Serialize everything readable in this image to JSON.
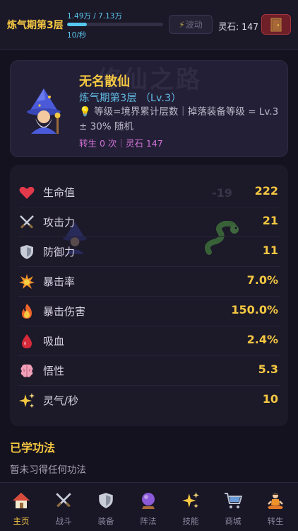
{
  "topbar": {
    "realm": "炼气期第3层",
    "exp_text": "1.49万 / 7.13万",
    "exp_progress": 0.209,
    "rate_text": "10/秒",
    "ripple_label": "波动",
    "stones_text": "灵石: 147",
    "exit_icon": "door-icon"
  },
  "profile": {
    "watermark": "修仙之路",
    "name": "无名散仙",
    "level": "炼气期第3层 （Lv.3）",
    "hint": "等级=境界累计层数｜掉落装备等级 = Lv.3 ± 30% 随机",
    "rebirth": "转生 0 次｜灵石 147"
  },
  "stats": [
    {
      "icon": "heart-icon",
      "label": "生命值",
      "value": "222"
    },
    {
      "icon": "crossed-swords-icon",
      "label": "攻击力",
      "value": "21"
    },
    {
      "icon": "shield-icon",
      "label": "防御力",
      "value": "11"
    },
    {
      "icon": "collision-icon",
      "label": "暴击率",
      "value": "7.0%"
    },
    {
      "icon": "fire-icon",
      "label": "暴击伤害",
      "value": "150.0%"
    },
    {
      "icon": "blood-drop-icon",
      "label": "吸血",
      "value": "2.4%"
    },
    {
      "icon": "brain-icon",
      "label": "悟性",
      "value": "5.3"
    },
    {
      "icon": "sparkles-icon",
      "label": "灵气/秒",
      "value": "10"
    }
  ],
  "ghost_number": "-19",
  "skills": {
    "title": "已学功法",
    "empty_text": "暂未习得任何功法"
  },
  "nav": [
    {
      "icon": "house-icon",
      "label": "主页",
      "active": true
    },
    {
      "icon": "crossed-swords-icon",
      "label": "战斗",
      "active": false
    },
    {
      "icon": "shield-icon",
      "label": "装备",
      "active": false
    },
    {
      "icon": "crystal-ball-icon",
      "label": "阵法",
      "active": false
    },
    {
      "icon": "sparkles-icon",
      "label": "技能",
      "active": false
    },
    {
      "icon": "cart-icon",
      "label": "商城",
      "active": false
    },
    {
      "icon": "meditation-icon",
      "label": "转生",
      "active": false
    }
  ],
  "colors": {
    "gold": "#f5c842",
    "cyan": "#58c3e8",
    "purple": "#d071d6",
    "exit_red": "#6e1f28"
  }
}
